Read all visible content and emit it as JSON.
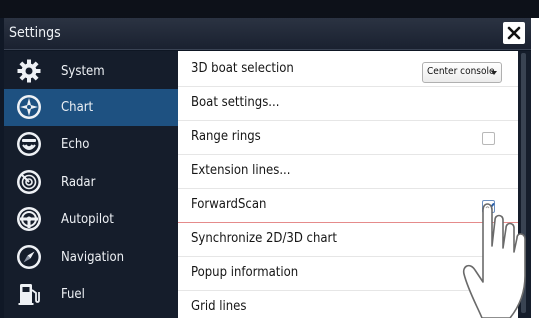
{
  "window": {
    "title": "Settings"
  },
  "sidebar": {
    "items": [
      {
        "label": "System",
        "icon": "gear-icon",
        "active": false
      },
      {
        "label": "Chart",
        "icon": "chart-compass-icon",
        "active": true
      },
      {
        "label": "Echo",
        "icon": "echo-sonar-icon",
        "active": false
      },
      {
        "label": "Radar",
        "icon": "radar-icon",
        "active": false
      },
      {
        "label": "Autopilot",
        "icon": "helm-wheel-icon",
        "active": false
      },
      {
        "label": "Navigation",
        "icon": "navigation-compass-icon",
        "active": false
      },
      {
        "label": "Fuel",
        "icon": "fuel-pump-icon",
        "active": false
      }
    ]
  },
  "settings": {
    "rows": [
      {
        "label": "3D boat selection",
        "control": "select",
        "value": "Center console"
      },
      {
        "label": "Boat settings...",
        "control": "none"
      },
      {
        "label": "Range rings",
        "control": "checkbox",
        "checked": false
      },
      {
        "label": "Extension lines...",
        "control": "none"
      },
      {
        "label": "ForwardScan",
        "control": "checkbox",
        "checked": true
      },
      {
        "label": "Synchronize 2D/3D chart",
        "control": "none"
      },
      {
        "label": "Popup information",
        "control": "none"
      },
      {
        "label": "Grid lines",
        "control": "checkbox",
        "checked": false
      }
    ]
  },
  "colors": {
    "title_bar": "#1a2130",
    "sidebar_bg": "#151d2b",
    "active_item": "#1e5181",
    "content_bg": "#ffffff",
    "selected_row_divider": "#e58b8b",
    "check_mark": "#2a5fa8"
  }
}
